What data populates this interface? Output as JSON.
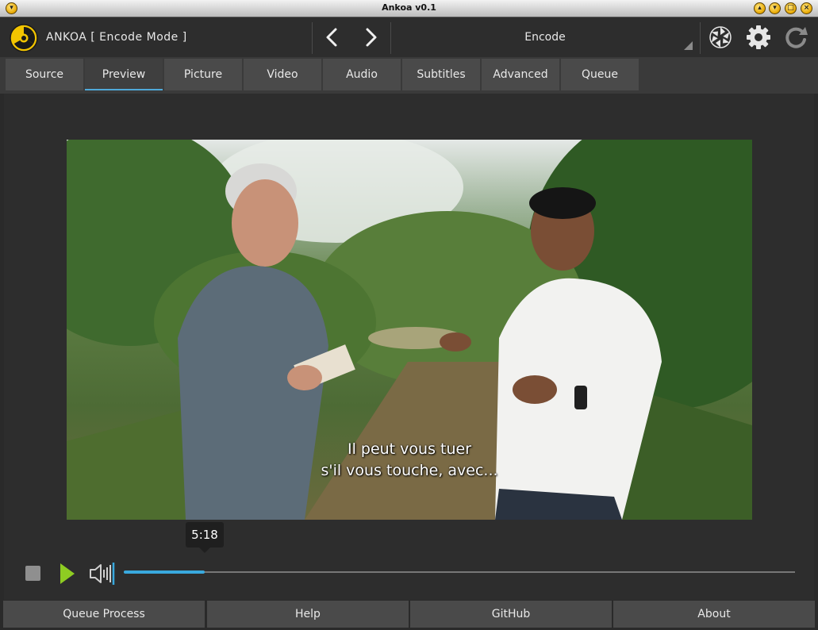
{
  "window": {
    "title": "Ankoa v0.1"
  },
  "header": {
    "app_title": "ANKOA  [ Encode  Mode ]",
    "mode_selector": "Encode"
  },
  "tabs": [
    {
      "label": "Source",
      "active": false
    },
    {
      "label": "Preview",
      "active": true
    },
    {
      "label": "Picture",
      "active": false
    },
    {
      "label": "Video",
      "active": false
    },
    {
      "label": "Audio",
      "active": false
    },
    {
      "label": "Subtitles",
      "active": false
    },
    {
      "label": "Advanced",
      "active": false
    },
    {
      "label": "Queue",
      "active": false
    }
  ],
  "preview": {
    "subtitle_line1": "Il peut vous tuer",
    "subtitle_line2": "s'il vous touche, avec..."
  },
  "player": {
    "time_tooltip": "5:18",
    "progress_fraction": 0.12
  },
  "bottom_buttons": [
    {
      "label": "Queue Process"
    },
    {
      "label": "Help"
    },
    {
      "label": "GitHub"
    },
    {
      "label": "About"
    }
  ],
  "colors": {
    "accent": "#4fa9d9",
    "play": "#8ecc22",
    "logo_yellow": "#f2c400"
  }
}
